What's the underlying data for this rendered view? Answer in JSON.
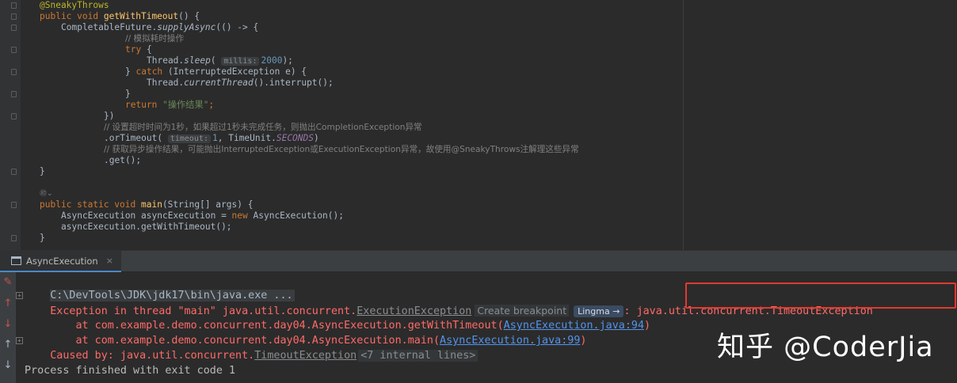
{
  "editor": {
    "lines": [
      {
        "row": 0,
        "indent": 0,
        "spans": [
          {
            "t": "@SneakyThrows",
            "c": "ann"
          }
        ]
      },
      {
        "row": 1,
        "indent": 0,
        "spans": [
          {
            "t": "public void ",
            "c": "kw"
          },
          {
            "t": "getWithTimeout",
            "c": "fn"
          },
          {
            "t": "() {",
            "c": ""
          }
        ]
      },
      {
        "row": 2,
        "indent": 4,
        "spans": [
          {
            "t": "CompletableFuture.",
            "c": ""
          },
          {
            "t": "supplyAsync",
            "c": "it"
          },
          {
            "t": "(() -> {",
            "c": ""
          }
        ]
      },
      {
        "row": 3,
        "indent": 16,
        "spans": [
          {
            "t": "// 模拟耗时操作",
            "c": "cmt"
          }
        ]
      },
      {
        "row": 4,
        "indent": 16,
        "spans": [
          {
            "t": "try",
            "c": "kw"
          },
          {
            "t": " {",
            "c": ""
          }
        ]
      },
      {
        "row": 5,
        "indent": 20,
        "spans": [
          {
            "t": "Thread.",
            "c": ""
          },
          {
            "t": "sleep",
            "c": "it"
          },
          {
            "t": "( ",
            "c": ""
          },
          {
            "t": "millis:",
            "c": "hint"
          },
          {
            "t": "2000",
            "c": "num"
          },
          {
            "t": ");",
            "c": ""
          }
        ]
      },
      {
        "row": 6,
        "indent": 16,
        "spans": [
          {
            "t": "} ",
            "c": ""
          },
          {
            "t": "catch",
            "c": "kw"
          },
          {
            "t": " (InterruptedException e) {",
            "c": ""
          }
        ]
      },
      {
        "row": 7,
        "indent": 20,
        "spans": [
          {
            "t": "Thread.",
            "c": ""
          },
          {
            "t": "currentThread",
            "c": "it"
          },
          {
            "t": "().interrupt();",
            "c": ""
          }
        ]
      },
      {
        "row": 8,
        "indent": 16,
        "spans": [
          {
            "t": "}",
            "c": ""
          }
        ]
      },
      {
        "row": 9,
        "indent": 16,
        "spans": [
          {
            "t": "return ",
            "c": "kw"
          },
          {
            "t": "\"操作结果\"",
            "c": "str"
          },
          {
            "t": ";",
            "c": "kw"
          }
        ]
      },
      {
        "row": 10,
        "indent": 12,
        "spans": [
          {
            "t": "})",
            "c": ""
          }
        ]
      },
      {
        "row": 11,
        "indent": 12,
        "spans": [
          {
            "t": "// 设置超时时间为1秒，如果超过1秒未完成任务，则抛出CompletionException异常",
            "c": "cmt"
          }
        ]
      },
      {
        "row": 12,
        "indent": 12,
        "spans": [
          {
            "t": ".orTimeout( ",
            "c": ""
          },
          {
            "t": "timeout:",
            "c": "hint"
          },
          {
            "t": "1",
            "c": "num"
          },
          {
            "t": ", TimeUnit.",
            "c": ""
          },
          {
            "t": "SECONDS",
            "c": "const"
          },
          {
            "t": ")",
            "c": ""
          }
        ]
      },
      {
        "row": 13,
        "indent": 12,
        "spans": [
          {
            "t": "// 获取异步操作结果，可能抛出InterruptedException或ExecutionException异常，故使用@SneakyThrows注解理这些异常",
            "c": "cmt"
          }
        ]
      },
      {
        "row": 14,
        "indent": 12,
        "spans": [
          {
            "t": ".get();",
            "c": ""
          }
        ]
      },
      {
        "row": 15,
        "indent": 0,
        "spans": [
          {
            "t": "}",
            "c": ""
          }
        ]
      },
      {
        "row": 18,
        "indent": 0,
        "spans": [
          {
            "t": "public static void ",
            "c": "kw"
          },
          {
            "t": "main",
            "c": "fn"
          },
          {
            "t": "(String[] args) {",
            "c": ""
          }
        ]
      },
      {
        "row": 19,
        "indent": 4,
        "spans": [
          {
            "t": "AsyncExecution asyncExecution = ",
            "c": ""
          },
          {
            "t": "new ",
            "c": "kw"
          },
          {
            "t": "AsyncExecution();",
            "c": ""
          }
        ]
      },
      {
        "row": 20,
        "indent": 4,
        "spans": [
          {
            "t": "asyncExecution.getWithTimeout();",
            "c": ""
          }
        ]
      },
      {
        "row": 21,
        "indent": 0,
        "spans": [
          {
            "t": "}",
            "c": ""
          }
        ]
      }
    ],
    "inlay_icon": "㊞⌄",
    "fold_marker_rows": [
      0,
      1,
      2,
      4,
      6,
      8,
      10,
      15,
      18,
      21
    ]
  },
  "run_panel": {
    "tab_label": "AsyncExecution",
    "tab_close": "×",
    "tab_icon": "console-window-icon"
  },
  "console": {
    "toolbar": [
      {
        "name": "edit-config-icon",
        "glyph": "✎",
        "color": "#c75450"
      },
      {
        "name": "scroll-up-icon",
        "glyph": "↑",
        "color": "#c75450"
      },
      {
        "name": "scroll-down-icon",
        "glyph": "↓",
        "color": "#c75450"
      },
      {
        "name": "up-arrow-icon",
        "glyph": "↑",
        "color": "#a9b7c6"
      },
      {
        "name": "down-arrow-icon",
        "glyph": "↓",
        "color": "#a9b7c6"
      }
    ],
    "command": "C:\\DevTools\\JDK\\jdk17\\bin\\java.exe ...",
    "exception_prefix": "Exception in thread \"main\" java.util.concurrent.",
    "exception_class_link": "ExecutionException",
    "create_breakpoint": "Create breakpoint",
    "lingma_label": "Lingma →",
    "exception_colon": ": ",
    "exception_cause": "java.util.concurrent.TimeoutException",
    "stack": [
      {
        "prefix": "    at com.example.demo.concurrent.day04.AsyncExecution.getWithTimeout(",
        "link": "AsyncExecution.java:94",
        "suffix": ")"
      },
      {
        "prefix": "    at com.example.demo.concurrent.day04.AsyncExecution.main(",
        "link": "AsyncExecution.java:99",
        "suffix": ")"
      }
    ],
    "caused_prefix": "Caused by: java.util.concurrent.",
    "caused_link": "TimeoutException",
    "internal_lines": "<7 internal lines>",
    "process_finished": "Process finished with exit code 1",
    "expand_glyph": "+"
  },
  "watermark": "知乎 @CoderJia",
  "colors": {
    "background": "#2b2b2b",
    "error_text": "#ff6b68",
    "link": "#5394ec",
    "highlight_box": "#e23a2f"
  }
}
